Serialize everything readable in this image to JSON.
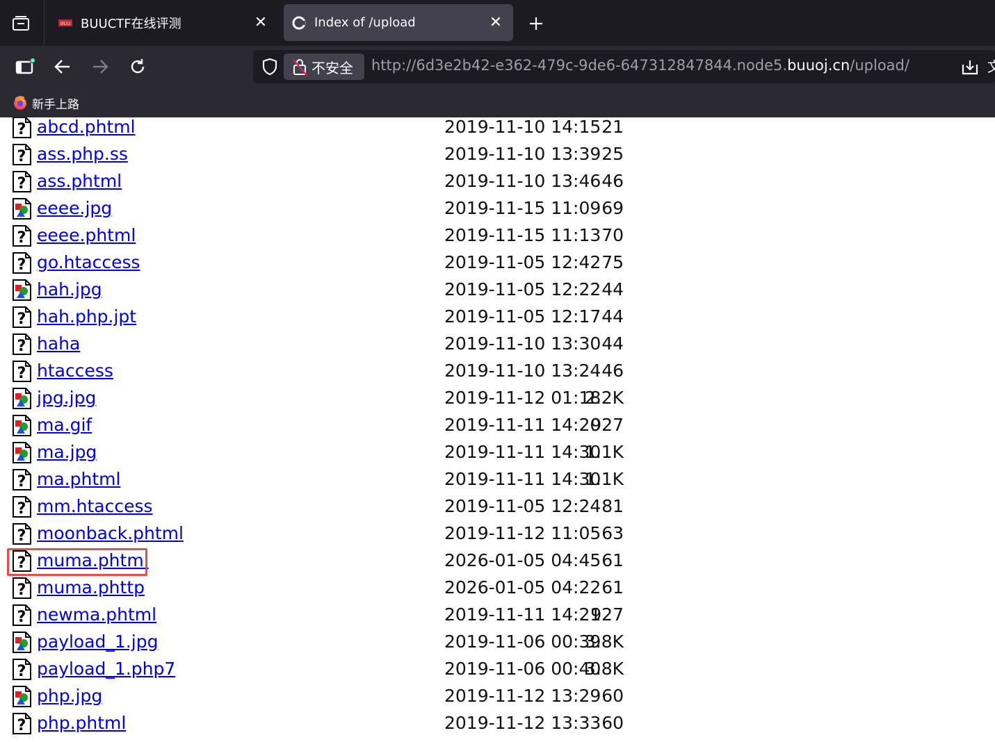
{
  "browser": {
    "tabs": [
      {
        "title": "BUUCTF在线评测",
        "active": false,
        "favicon": "buuctf-logo-icon"
      },
      {
        "title": "Index of /upload",
        "active": true,
        "favicon": "page-icon"
      }
    ],
    "security_label": "不安全",
    "url_prefix": "http://6d3e2b42-e362-479c-9de6-647312847844.node5.",
    "url_host": "buuoj.cn",
    "url_path": "/upload/",
    "bookmarks": [
      {
        "label": "新手上路",
        "icon": "firefox-icon"
      }
    ]
  },
  "listing": {
    "files": [
      {
        "name": "abcd.phtml",
        "date": "2019-11-10 14:15",
        "size": "21",
        "icon": "unknown-file-icon"
      },
      {
        "name": "ass.php.ss",
        "date": "2019-11-10 13:39",
        "size": "25",
        "icon": "unknown-file-icon"
      },
      {
        "name": "ass.phtml",
        "date": "2019-11-10 13:46",
        "size": "46",
        "icon": "unknown-file-icon"
      },
      {
        "name": "eeee.jpg",
        "date": "2019-11-15 11:09",
        "size": "69",
        "icon": "image-file-icon"
      },
      {
        "name": "eeee.phtml",
        "date": "2019-11-15 11:13",
        "size": "70",
        "icon": "unknown-file-icon"
      },
      {
        "name": "go.htaccess",
        "date": "2019-11-05 12:42",
        "size": "75",
        "icon": "unknown-file-icon"
      },
      {
        "name": "hah.jpg",
        "date": "2019-11-05 12:22",
        "size": "44",
        "icon": "image-file-icon"
      },
      {
        "name": "hah.php.jpt",
        "date": "2019-11-05 12:17",
        "size": "44",
        "icon": "unknown-file-icon"
      },
      {
        "name": "haha",
        "date": "2019-11-10 13:30",
        "size": "44",
        "icon": "unknown-file-icon"
      },
      {
        "name": "htaccess",
        "date": "2019-11-10 13:24",
        "size": "46",
        "icon": "unknown-file-icon"
      },
      {
        "name": "jpg.jpg",
        "date": "2019-11-12 01:18",
        "size": "2.2K",
        "icon": "image-file-icon"
      },
      {
        "name": "ma.gif",
        "date": "2019-11-11 14:20",
        "size": "927",
        "icon": "image-file-icon"
      },
      {
        "name": "ma.jpg",
        "date": "2019-11-11 14:30",
        "size": "1.1K",
        "icon": "image-file-icon"
      },
      {
        "name": "ma.phtml",
        "date": "2019-11-11 14:30",
        "size": "1.1K",
        "icon": "unknown-file-icon"
      },
      {
        "name": "mm.htaccess",
        "date": "2019-11-05 12:24",
        "size": "81",
        "icon": "unknown-file-icon"
      },
      {
        "name": "moonback.phtml",
        "date": "2019-11-12 11:05",
        "size": "63",
        "icon": "unknown-file-icon"
      },
      {
        "name": "muma.phtml",
        "date": "2026-01-05 04:45",
        "size": "61",
        "icon": "unknown-file-icon",
        "highlighted": true
      },
      {
        "name": "muma.phttp",
        "date": "2026-01-05 04:22",
        "size": "61",
        "icon": "unknown-file-icon"
      },
      {
        "name": "newma.phtml",
        "date": "2019-11-11 14:21",
        "size": "927",
        "icon": "unknown-file-icon"
      },
      {
        "name": "payload_1.jpg",
        "date": "2019-11-06 00:39",
        "size": "3.8K",
        "icon": "image-file-icon"
      },
      {
        "name": "payload_1.php7",
        "date": "2019-11-06 00:40",
        "size": "3.8K",
        "icon": "unknown-file-icon"
      },
      {
        "name": "php.jpg",
        "date": "2019-11-12 13:29",
        "size": "60",
        "icon": "image-file-icon"
      },
      {
        "name": "php.phtml",
        "date": "2019-11-12 13:33",
        "size": "60",
        "icon": "unknown-file-icon"
      }
    ],
    "highlight_color": "#ea4b4b",
    "link_color": "#0000ee"
  }
}
